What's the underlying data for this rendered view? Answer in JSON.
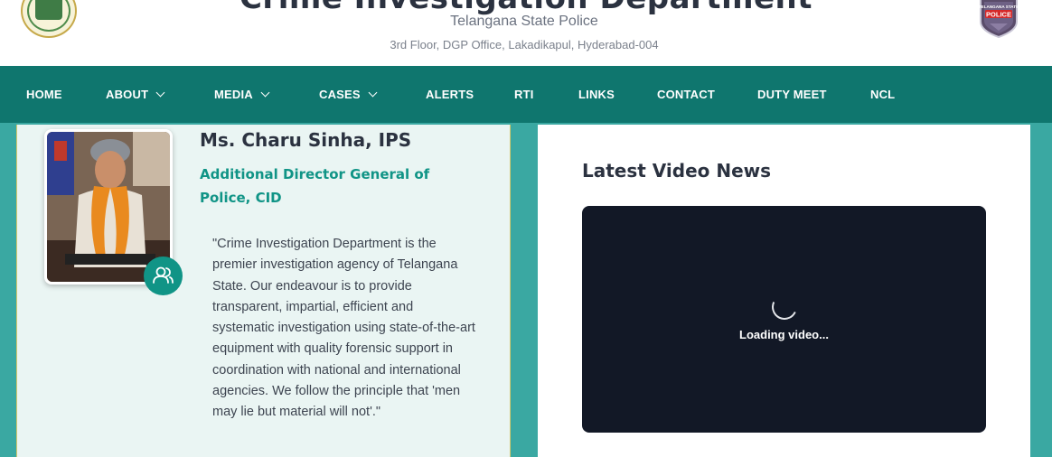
{
  "header": {
    "title": "Crime Investigation Department",
    "subtitle": "Telangana State Police",
    "address": "3rd Floor, DGP Office, Lakadikapul, Hyderabad-004",
    "badge_text_top": "TELANGANA STATE",
    "badge_text_main": "POLICE"
  },
  "nav": {
    "items": [
      {
        "label": "HOME",
        "dropdown": false
      },
      {
        "label": "ABOUT",
        "dropdown": true
      },
      {
        "label": "MEDIA",
        "dropdown": true
      },
      {
        "label": "CASES",
        "dropdown": true
      },
      {
        "label": "ALERTS",
        "dropdown": false
      },
      {
        "label": "RTI",
        "dropdown": false
      },
      {
        "label": "LINKS",
        "dropdown": false
      },
      {
        "label": "CONTACT",
        "dropdown": false
      },
      {
        "label": "DUTY MEET",
        "dropdown": false
      },
      {
        "label": "NCL",
        "dropdown": false
      }
    ]
  },
  "profile": {
    "name": "Ms. Charu Sinha, IPS",
    "designation": "Additional Director General of Police, CID",
    "quote": "\"Crime Investigation Department is the premier investigation agency of Telangana State. Our endeavour is to provide transparent, impartial, efficient and systematic investigation using state-of-the-art equipment with quality forensic support in coordination with national and international agencies. We follow the principle that 'men may lie but material will not'.\""
  },
  "video": {
    "title": "Latest Video News",
    "loading_text": "Loading video..."
  },
  "colors": {
    "nav_bg": "#0f766e",
    "accent": "#109486",
    "page_bg": "#3aa8a2",
    "video_bg": "#121826"
  }
}
